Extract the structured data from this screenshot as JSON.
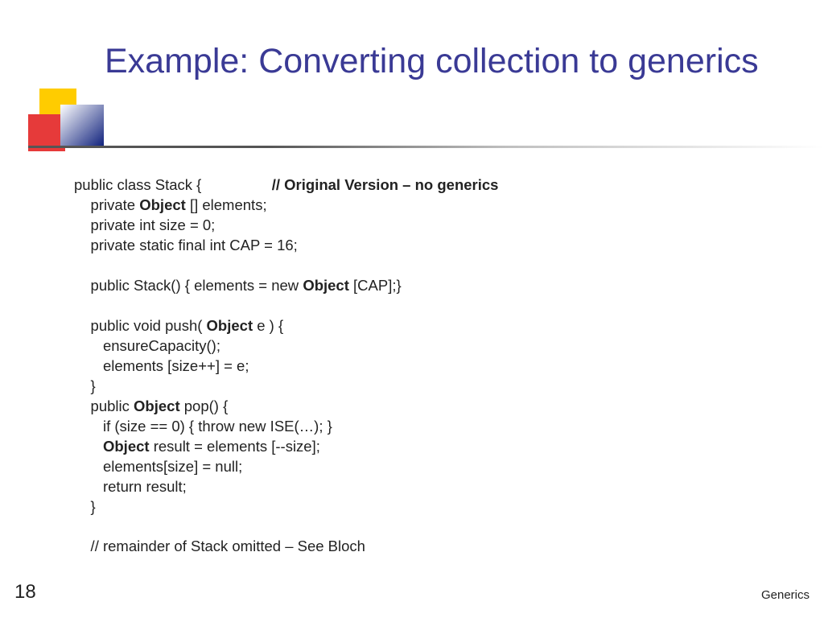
{
  "title": "Example: Converting collection to generics",
  "slide_number": "18",
  "footer": "Generics",
  "code": {
    "l0a": "public class Stack {",
    "l0b": "// Original Version – no generics",
    "l1a": "    private ",
    "l1b": "Object",
    "l1c": " [] elements;",
    "l2": "    private int size = 0;",
    "l3": "    private static final int CAP = 16;",
    "l4a": "    public Stack() { elements = new ",
    "l4b": "Object",
    "l4c": " [CAP];}",
    "l5a": "    public void push( ",
    "l5b": "Object",
    "l5c": " e ) {",
    "l6": "       ensureCapacity();",
    "l7": "       elements [size++] = e;",
    "l8": "    }",
    "l9a": "    public ",
    "l9b": "Object",
    "l9c": " pop() {",
    "l10": "       if (size == 0) { throw new ISE(…); }",
    "l11a": "       ",
    "l11b": "Object",
    "l11c": " result = elements [--size];",
    "l12": "       elements[size] = null;",
    "l13": "       return result;",
    "l14": "    }",
    "l15": "    // remainder of Stack omitted – See Bloch"
  }
}
